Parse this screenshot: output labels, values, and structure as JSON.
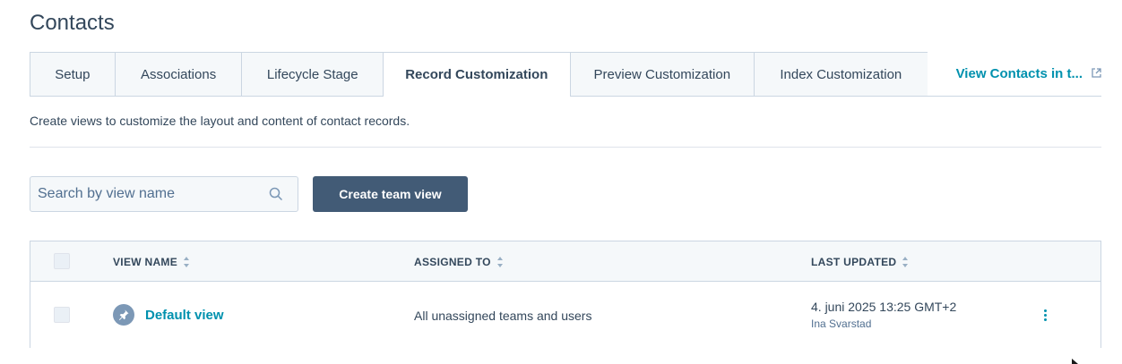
{
  "page": {
    "title": "Contacts"
  },
  "tabs": [
    {
      "label": "Setup"
    },
    {
      "label": "Associations"
    },
    {
      "label": "Lifecycle Stage"
    },
    {
      "label": "Record Customization",
      "active": true
    },
    {
      "label": "Preview Customization"
    },
    {
      "label": "Index Customization"
    }
  ],
  "external_link": {
    "label": "View Contacts in t...",
    "icon": "external-link-icon"
  },
  "description": "Create views to customize the layout and content of contact records.",
  "search": {
    "placeholder": "Search by view name",
    "value": "",
    "icon": "search-icon"
  },
  "create_button": {
    "label": "Create team view"
  },
  "table": {
    "columns": [
      {
        "label": "VIEW NAME"
      },
      {
        "label": "ASSIGNED TO"
      },
      {
        "label": "LAST UPDATED"
      }
    ],
    "rows": [
      {
        "icon": "pin-icon",
        "view_name": "Default view",
        "assigned_to": "All unassigned teams and users",
        "last_updated": "4. juni 2025 13:25 GMT+2",
        "updated_by": "Ina Svarstad",
        "actions_icon": "more-vertical-icon"
      }
    ]
  },
  "colors": {
    "text": "#33475b",
    "link": "#0091ae",
    "button": "#425b76",
    "border": "#cbd6e2",
    "header_bg": "#f5f8fa"
  }
}
